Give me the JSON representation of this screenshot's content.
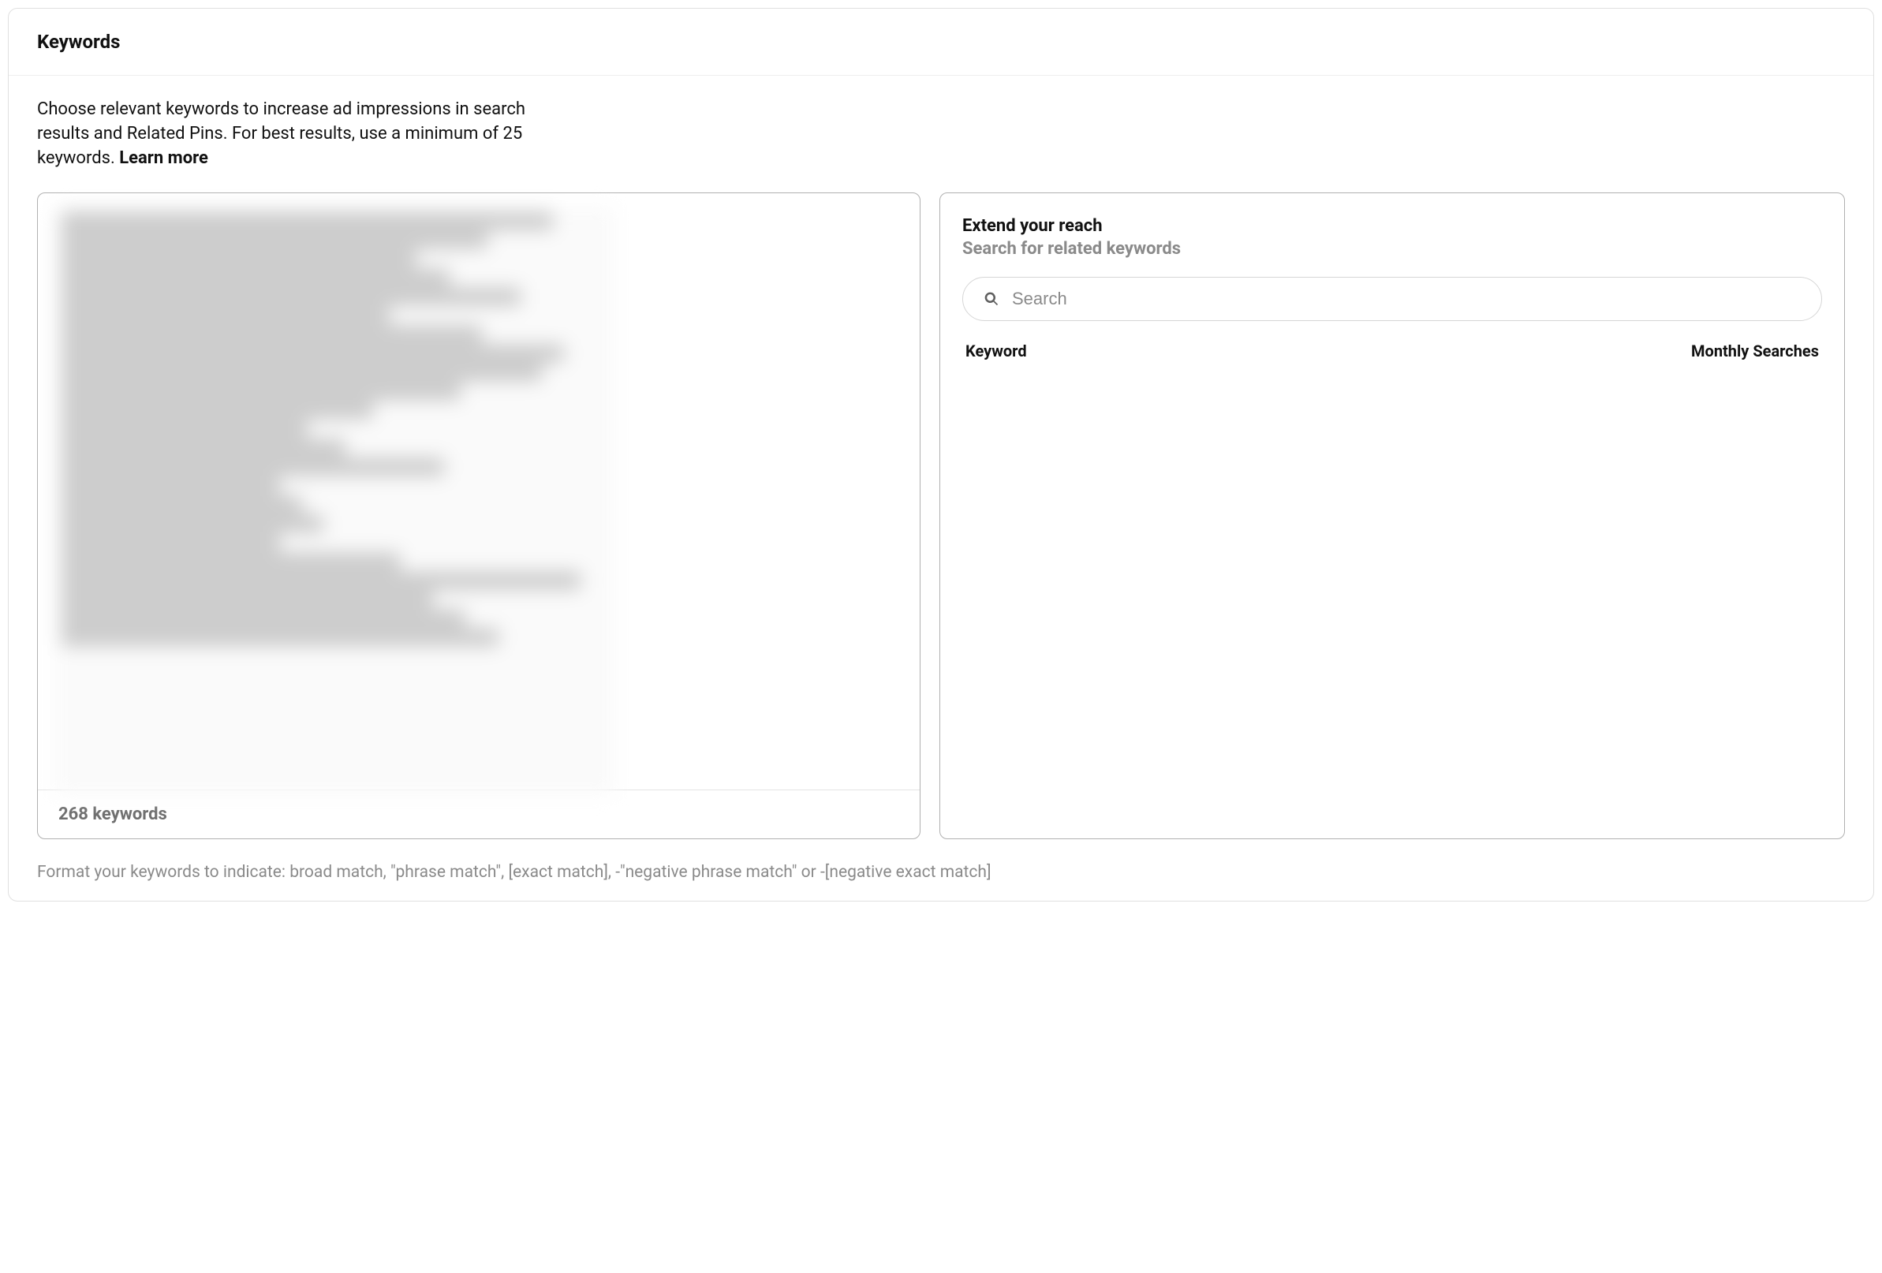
{
  "section": {
    "title": "Keywords",
    "intro_text": "Choose relevant keywords to increase ad impressions in search results and Related Pins. For best results, use a minimum of 25 keywords. ",
    "learn_more": "Learn more"
  },
  "keywords_panel": {
    "count_label": "268 keywords"
  },
  "extend_panel": {
    "title": "Extend your reach",
    "subtitle": "Search for related keywords",
    "search_placeholder": "Search",
    "col_keyword": "Keyword",
    "col_monthly": "Monthly Searches"
  },
  "footer_hint": "Format your keywords to indicate: broad match, \"phrase match\", [exact match], -\"negative phrase match\" or -[negative exact match]"
}
